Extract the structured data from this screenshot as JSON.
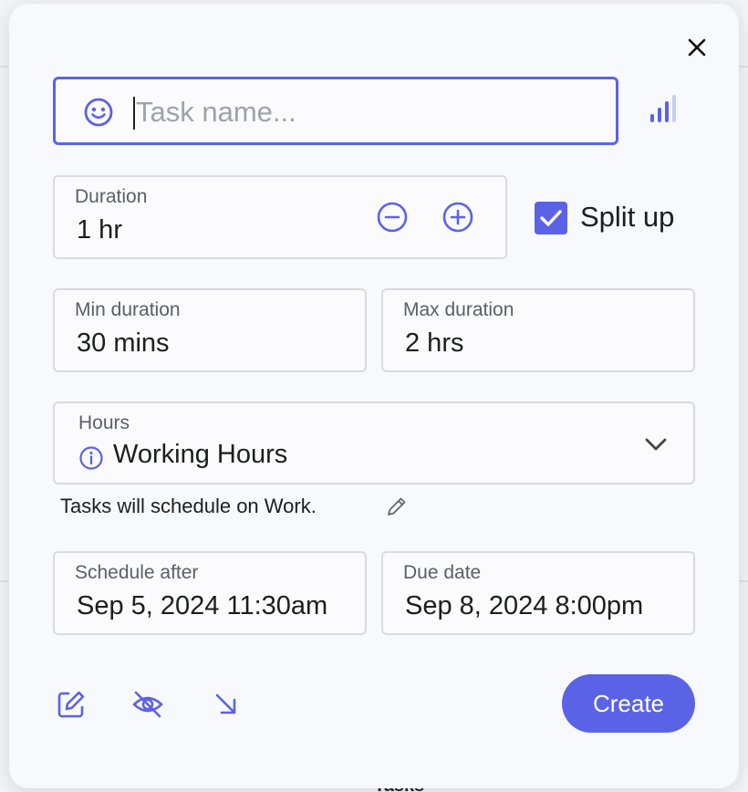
{
  "task": {
    "placeholder": "Task name...",
    "value": ""
  },
  "duration": {
    "label": "Duration",
    "value": "1 hr"
  },
  "split_up": {
    "label": "Split up",
    "checked": true
  },
  "min_duration": {
    "label": "Min duration",
    "value": "30 mins"
  },
  "max_duration": {
    "label": "Max duration",
    "value": "2 hrs"
  },
  "hours": {
    "label": "Hours",
    "value": "Working Hours"
  },
  "helper_text": "Tasks will schedule on Work.",
  "schedule_after": {
    "label": "Schedule after",
    "value": "Sep 5, 2024 11:30am"
  },
  "due_date": {
    "label": "Due date",
    "value": "Sep 8, 2024 8:00pm"
  },
  "create_label": "Create",
  "colors": {
    "accent": "#5a63e6",
    "border": "#d8dadf",
    "text": "#1c1d21"
  },
  "icons": [
    "close-icon",
    "smile-icon",
    "priority-icon",
    "minus-circle-icon",
    "plus-circle-icon",
    "checkmark-icon",
    "info-icon",
    "chevron-down-icon",
    "pencil-icon",
    "edit-icon",
    "eye-off-icon",
    "arrow-down-right-icon"
  ]
}
